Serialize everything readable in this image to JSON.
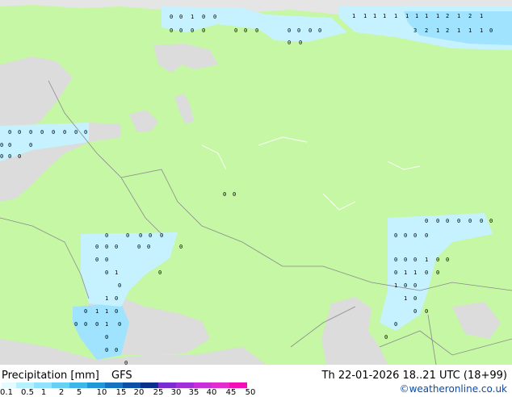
{
  "legend": {
    "title": "Precipitation [mm]",
    "model": "GFS",
    "ticks": [
      "0.1",
      "0.5",
      "1",
      "2",
      "5",
      "10",
      "15",
      "20",
      "25",
      "30",
      "35",
      "40",
      "45",
      "50"
    ],
    "colors": [
      "#e6fbff",
      "#b7f0ff",
      "#8fe3ff",
      "#66d0f5",
      "#3fb6ea",
      "#2196d8",
      "#1473c4",
      "#0b4fa8",
      "#0a2f8c",
      "#7a2bd1",
      "#a12ed6",
      "#c72fd9",
      "#e22bd0",
      "#f20fb8"
    ]
  },
  "valid_time": "Th 22-01-2026 18..21 UTC (18+99)",
  "credit": "©weatheronline.co.uk",
  "colors": {
    "land": "#c5f7a5",
    "outside": "#e5e5e5",
    "water": "#dcdcdc",
    "light_precip": "#c6f2ff",
    "moderate_precip": "#9fe3ff",
    "border": "#8a8a8a"
  },
  "rain_values": [
    {
      "area": "arctic-top-left",
      "values": [
        "0",
        "0",
        "1",
        "0",
        "0",
        "0",
        "0",
        "0",
        "0",
        "0",
        "0",
        "0",
        "0",
        "0",
        "0",
        "0",
        "0",
        "0"
      ]
    },
    {
      "area": "arctic-top-right",
      "values": [
        "1",
        "1",
        "1",
        "1",
        "1",
        "1",
        "1",
        "1",
        "1",
        "2",
        "1",
        "2",
        "1",
        "3",
        "2",
        "1",
        "2",
        "1",
        "1",
        "1",
        "0"
      ]
    },
    {
      "area": "baltic",
      "values": [
        "0",
        "0",
        "0",
        "0",
        "0",
        "0",
        "0",
        "0",
        "0",
        "0",
        "0",
        "0",
        "0",
        "0"
      ]
    },
    {
      "area": "central",
      "values": [
        "0",
        "0"
      ]
    },
    {
      "area": "ukraine-black-sea",
      "values": [
        "0",
        "0",
        "0",
        "0",
        "0",
        "0",
        "0",
        "0",
        "0",
        "0",
        "0",
        "0",
        "0",
        "0",
        "1",
        "0",
        "0",
        "1",
        "0",
        "0",
        "1",
        "1",
        "0",
        "0",
        "0",
        "0",
        "1",
        "0",
        "0",
        "0",
        "0",
        "0"
      ]
    },
    {
      "area": "caspian-kazakhstan",
      "values": [
        "0",
        "0",
        "0",
        "0",
        "0",
        "0",
        "0",
        "0",
        "0",
        "0",
        "0",
        "0",
        "0",
        "0",
        "1",
        "0",
        "0",
        "0",
        "1",
        "1",
        "0",
        "0",
        "1",
        "0",
        "0",
        "1",
        "0",
        "0",
        "0",
        "0",
        "0"
      ]
    }
  ]
}
